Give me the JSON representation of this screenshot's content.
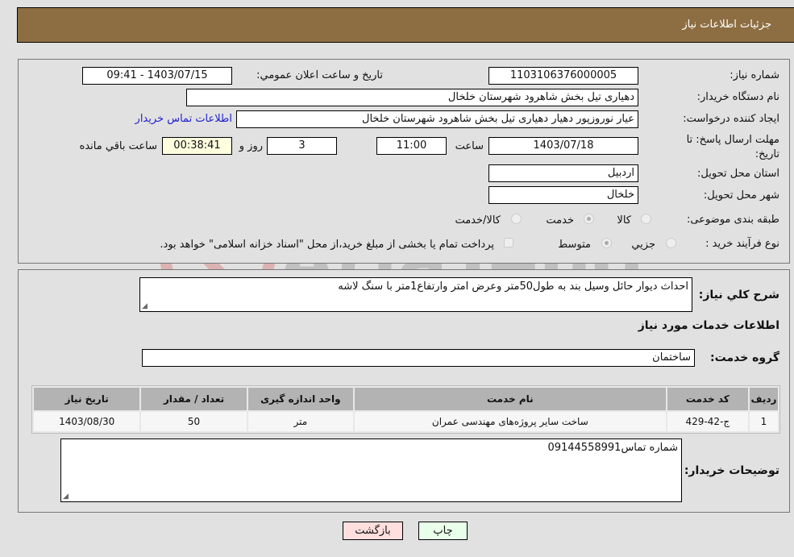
{
  "header": {
    "title": "جزئیات اطلاعات نیاز"
  },
  "watermark": {
    "text": "AriaTender.neT"
  },
  "details": {
    "need_number_label": "شماره نیاز:",
    "need_number": "1103106376000005",
    "announce_label": "تاریخ و ساعت اعلان عمومي:",
    "announce_value": "1403/07/15 - 09:41",
    "buyer_org_label": "نام دستگاه خریدار:",
    "buyer_org": "دهیاری تیل بخش شاهرود شهرستان خلخال",
    "creator_label": "ایجاد کننده درخواست:",
    "creator": "عیار نوروزپور دهیار دهیاری تیل بخش شاهرود شهرستان خلخال",
    "contact_link": "اطلاعات تماس خریدار",
    "deadline_label": "مهلت ارسال پاسخ: تا تاریخ:",
    "deadline_date": "1403/07/18",
    "time_label": "ساعت",
    "deadline_time": "11:00",
    "days_value": "3",
    "days_label": "روز و",
    "remaining_time": "00:38:41",
    "remaining_label": "ساعت باقي مانده",
    "province_label": "استان محل تحویل:",
    "province": "اردبیل",
    "city_label": "شهر محل تحویل:",
    "city": "خلخال",
    "category_label": "طبقه بندی موضوعی:",
    "category_options": [
      {
        "label": "کالا",
        "selected": false
      },
      {
        "label": "خدمت",
        "selected": true
      },
      {
        "label": "کالا/خدمت",
        "selected": false
      }
    ],
    "process_label": "نوع فرآیند خرید :",
    "process_options": [
      {
        "label": "جزيي",
        "selected": false
      },
      {
        "label": "متوسط",
        "selected": true
      }
    ],
    "treasury_note": "پرداخت تمام یا بخشی از مبلغ خرید،از محل \"اسناد خزانه اسلامی\" خواهد بود."
  },
  "services": {
    "description_label": "شرح كلي نياز:",
    "description": "احداث دیوار حائل وسیل بند به طول50متر وعرض امتر وارتفاع1متر با سنگ لاشه",
    "section_title": "اطلاعات خدمات مورد نیاز",
    "group_label": "گروه خدمت:",
    "group_value": "ساختمان",
    "table": {
      "headers": [
        "ردیف",
        "کد خدمت",
        "نام خدمت",
        "واحد اندازه گیری",
        "تعداد / مقدار",
        "تاریخ نیاز"
      ],
      "rows": [
        [
          "1",
          "ج-42-429",
          "ساخت سایر پروژه‌های مهندسی عمران",
          "متر",
          "50",
          "1403/08/30"
        ]
      ]
    },
    "buyer_notes_label": "توضیحات خریدار:",
    "buyer_notes": "شماره تماس09144558991"
  },
  "buttons": {
    "print": "چاپ",
    "back": "بازگشت"
  },
  "colors": {
    "header_bg": "#8d6e42",
    "print_bg": "#eaffea",
    "back_bg": "#ffdede",
    "link": "#2020d0"
  }
}
